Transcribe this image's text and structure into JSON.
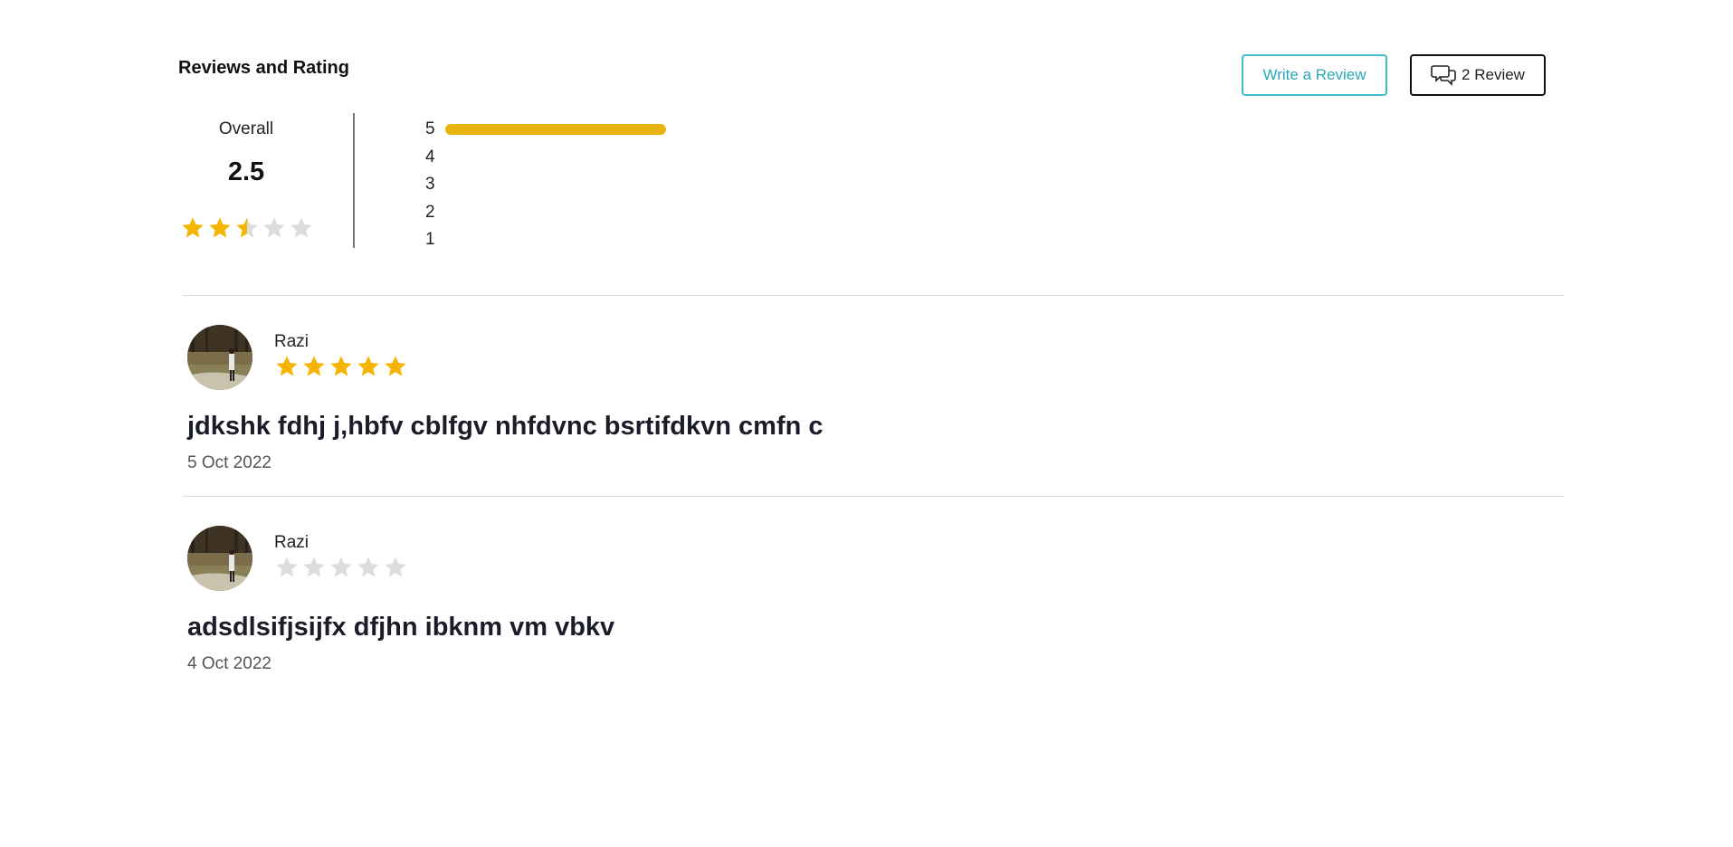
{
  "header": {
    "title": "Reviews and Rating",
    "write_review_label": "Write a Review",
    "review_count_label": "2 Review"
  },
  "summary": {
    "overall_label": "Overall",
    "score": "2.5",
    "rating_value": 2.5,
    "max_rating": 5,
    "distribution": [
      {
        "label": "5",
        "fraction": 0.5
      },
      {
        "label": "4",
        "fraction": 0
      },
      {
        "label": "3",
        "fraction": 0
      },
      {
        "label": "2",
        "fraction": 0
      },
      {
        "label": "1",
        "fraction": 0
      }
    ]
  },
  "reviews": [
    {
      "name": "Razi",
      "rating": 5,
      "title": "jdkshk fdhj j,hbfv cblfgv nhfdvnc bsrtifdkvn cmfn c",
      "date": "5 Oct 2022"
    },
    {
      "name": "Razi",
      "rating": 0,
      "title": "adsdlsifjsijfx dfjhn ibknm vm vbkv",
      "date": "4 Oct 2022"
    }
  ],
  "colors": {
    "star_filled": "#f5b400",
    "star_empty": "#dcdcdc",
    "bar_fill": "#e8b30f",
    "accent": "#3dbcc9"
  },
  "icons": {
    "review_count": "chat-bubbles-icon",
    "star": "star-icon",
    "avatar": "user-photo"
  }
}
